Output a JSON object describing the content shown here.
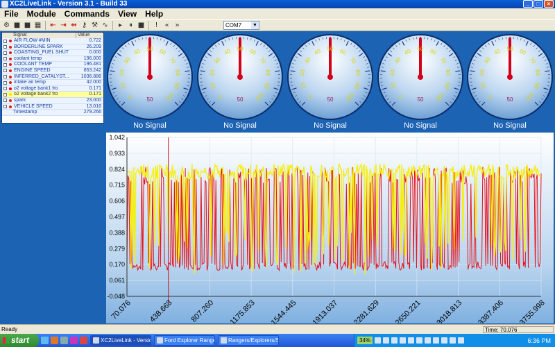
{
  "window": {
    "title": "XC2LiveLink - Version 3.1 - Build 33"
  },
  "menu": [
    "File",
    "Module",
    "Commands",
    "View",
    "Help"
  ],
  "toolbar": {
    "com_port": "COM7"
  },
  "signals": {
    "header": {
      "signal": "Signal",
      "value": "Value"
    },
    "rows": [
      {
        "name": "AIR FLOW #MIN",
        "value": "0.722",
        "dot": "#d21"
      },
      {
        "name": "BORDERLINE SPARK",
        "value": "26.209",
        "dot": "#d21"
      },
      {
        "name": "COASTING_FUEL SHUT",
        "value": "0.000",
        "dot": "#d21"
      },
      {
        "name": "coolant temp",
        "value": "196.000",
        "dot": "#d21"
      },
      {
        "name": "COOLANT TEMP",
        "value": "196.481",
        "dot": "#d21"
      },
      {
        "name": "ENGINE SPEED",
        "value": "853.242",
        "dot": "#d21"
      },
      {
        "name": "INFERRED_CATALYST...",
        "value": "1036.886",
        "dot": "#d21"
      },
      {
        "name": "intake air temp",
        "value": "42.000",
        "dot": "#d21"
      },
      {
        "name": "o2 voltage bank1 fro",
        "value": "0.171",
        "dot": "#e00"
      },
      {
        "name": "o2 voltage bank2 fro",
        "value": "0.171",
        "dot": "#ee0"
      },
      {
        "name": "spark",
        "value": "23.000",
        "dot": "#d21"
      },
      {
        "name": "VEHICLE SPEED",
        "value": "13.016",
        "dot": "#d21"
      },
      {
        "name": "Timestamp",
        "value": "279.266",
        "dot": ""
      }
    ]
  },
  "gauges": {
    "ticks": [
      "0",
      "10",
      "20",
      "30",
      "40",
      "50",
      "60",
      "70",
      "80",
      "90",
      "100"
    ],
    "unit": "50",
    "status": "No Signal"
  },
  "chart_data": {
    "type": "line",
    "y_ticks": [
      "1.042",
      "0.933",
      "0.824",
      "0.715",
      "0.606",
      "0.497",
      "0.388",
      "0.279",
      "0.170",
      "0.061",
      "-0.048"
    ],
    "ylim": [
      -0.048,
      1.042
    ],
    "x_ticks": [
      "70.076",
      "438.668",
      "807.260",
      "1175.853",
      "1544.445",
      "1913.037",
      "2281.629",
      "2650.221",
      "3018.813",
      "3387.406",
      "3755.998"
    ],
    "xlim": [
      70.076,
      3755.998
    ],
    "series": [
      {
        "name": "o2 voltage bank1 fro",
        "color": "#e8101a"
      },
      {
        "name": "o2 voltage bank2 fro",
        "color": "#f5ef10"
      }
    ],
    "cursor_x": 438.668
  },
  "status": {
    "text": "Ready",
    "time": "Time: 70.076"
  },
  "taskbar": {
    "start": "start",
    "tasks": [
      "XC2LiveLink - Version ...",
      "Ford Explorer Ranger...",
      "Rangers/Explorers/S..."
    ],
    "battery": "34%",
    "clock": "6:36 PM"
  }
}
